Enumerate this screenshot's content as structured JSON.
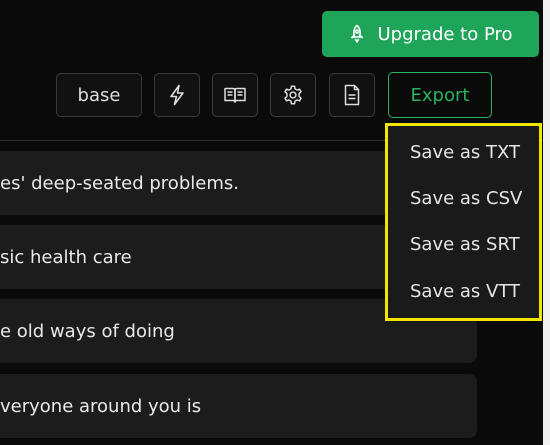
{
  "header": {
    "upgrade_label": "Upgrade to Pro",
    "upgrade_icon": "rocket-icon",
    "accent_color": "#1fa55a"
  },
  "toolbar": {
    "model_label": "base",
    "icons": [
      "lightning-icon",
      "book-open-icon",
      "gear-icon",
      "document-icon"
    ],
    "export_label": "Export"
  },
  "export_menu": {
    "items": [
      "Save as TXT",
      "Save as CSV",
      "Save as SRT",
      "Save as VTT"
    ],
    "highlight_color": "#f2e600"
  },
  "transcript": {
    "segments": [
      "es' deep-seated problems.",
      "sic health care",
      "e old ways of doing",
      "veryone around you is"
    ]
  }
}
